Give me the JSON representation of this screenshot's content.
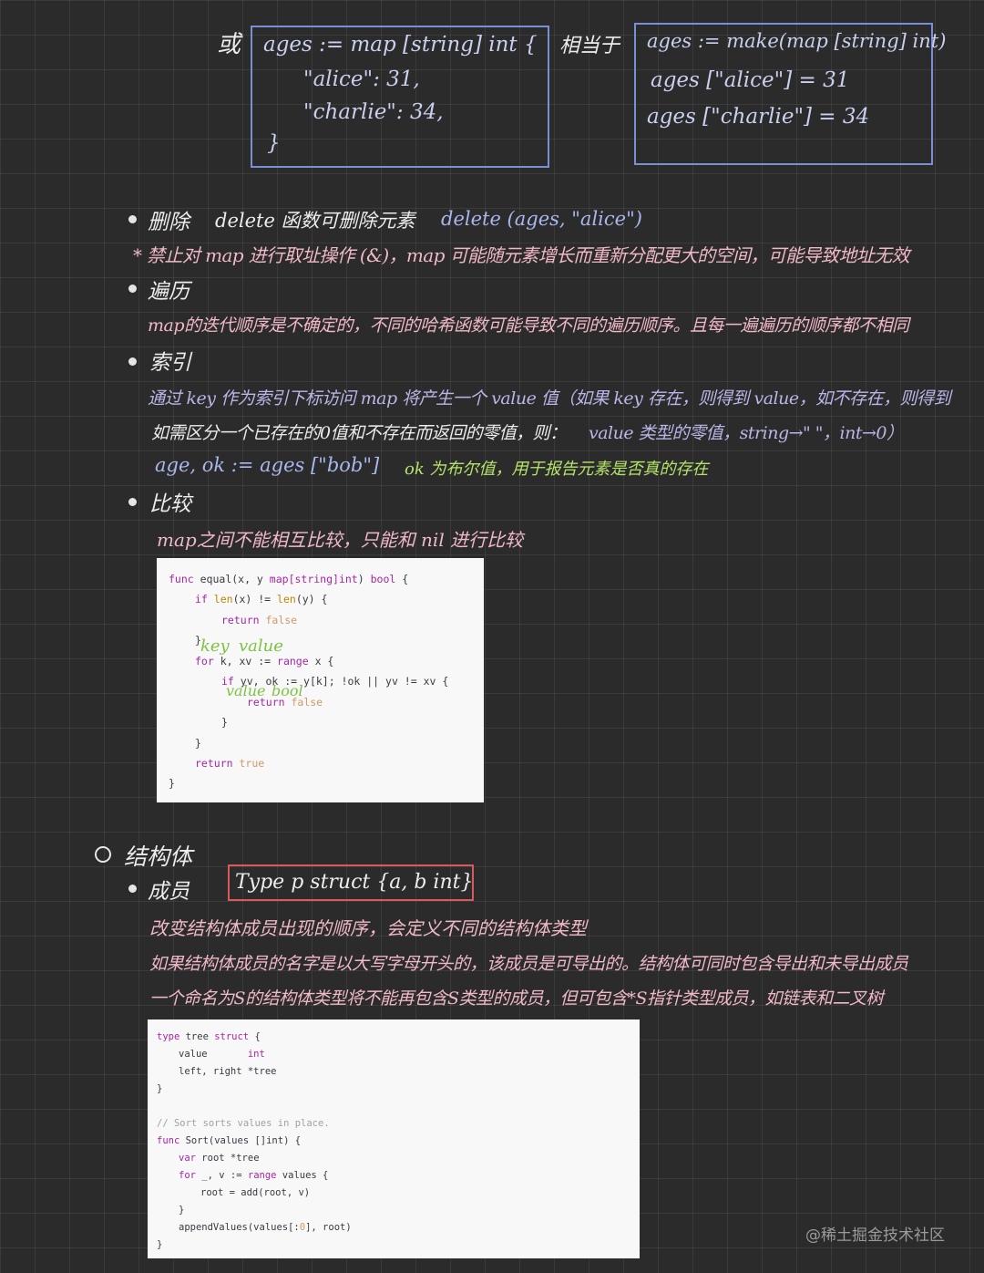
{
  "top": {
    "or_char": "或",
    "box1": [
      "ages := map [string] int {",
      "\"alice\": 31,",
      "\"charlie\": 34,",
      "}"
    ],
    "equiv": "相当于",
    "box2": [
      "ages := make(map [string] int)",
      "ages [\"alice\"] = 31",
      "ages [\"charlie\"] = 34"
    ]
  },
  "delete": {
    "head": "删除",
    "desc": "delete 函数可删除元素",
    "example": "delete (ages, \"alice\")",
    "note": "* 禁止对 map 进行取址操作 (&)，map 可能随元素增长而重新分配更大的空间，可能导致地址无效"
  },
  "traverse": {
    "head": "遍历",
    "desc": "map的迭代顺序是不确定的，不同的哈希函数可能导致不同的遍历顺序。且每一遍遍历的顺序都不相同"
  },
  "index": {
    "head": "索引",
    "line1": "通过 key 作为索引下标访问 map 将产生一个 value 值（如果 key 存在，则得到 value，如不存在，则得到",
    "line2a": "如需区分一个已存在的0值和不存在而返回的零值，则：",
    "line2b": "value 类型的零值，string→\" \"，int→0）",
    "line3": "age, ok := ages [\"bob\"]",
    "line3note": "ok 为布尔值，用于报告元素是否真的存在"
  },
  "compare": {
    "head": "比较",
    "desc": "map之间不能相互比较，只能和 nil 进行比较"
  },
  "code1": {
    "l1": {
      "a": "func ",
      "b": "equal(x, y ",
      "c": "map[string]int",
      "d": ") ",
      "e": "bool",
      "f": " {"
    },
    "l2": {
      "a": "if ",
      "b": "len",
      "c": "(x) != ",
      "d": "len",
      "e": "(y) {"
    },
    "l3": {
      "a": "return ",
      "b": "false"
    },
    "l4": "}",
    "l5": {
      "a": "for ",
      "b": "k, xv := ",
      "c": "range",
      "d": " x {"
    },
    "l6": {
      "a": "if ",
      "b": "yv, ok := y[k]; !ok || yv != xv {"
    },
    "l7": {
      "a": "return ",
      "b": "false"
    },
    "l8": "}",
    "l9": "}",
    "l10": {
      "a": "return ",
      "b": "true"
    },
    "l11": "}",
    "ann_key": "key",
    "ann_value": "value",
    "ann_value2": "value",
    "ann_bool": "bool"
  },
  "struct": {
    "head": "结构体",
    "member": "成员",
    "boxed": "Type p struct {a, b int}",
    "line1": "改变结构体成员出现的顺序，会定义不同的结构体类型",
    "line2": "如果结构体成员的名字是以大写字母开头的，该成员是可导出的。结构体可同时包含导出和未导出成员",
    "line3": "一个命名为S的结构体类型将不能再包含S类型的成员，但可包含*S指针类型成员，如链表和二叉树"
  },
  "code2": {
    "l1": {
      "a": "type ",
      "b": "tree ",
      "c": "struct",
      "d": " {"
    },
    "l2": {
      "a": "value       ",
      "b": "int"
    },
    "l3": "left, right *tree",
    "l4": "}",
    "l5": "// Sort sorts values in place.",
    "l6": {
      "a": "func ",
      "b": "Sort(values []int) {"
    },
    "l7": {
      "a": "var ",
      "b": "root *tree"
    },
    "l8": {
      "a": "for ",
      "b": "_, v := ",
      "c": "range",
      "d": " values {"
    },
    "l9": "root = add(root, v)",
    "l10": "}",
    "l11": {
      "a": "appendValues(values[:",
      "b": "0",
      "c": "], root)"
    },
    "l12": "}"
  },
  "watermark": "@稀土掘金技术社区"
}
